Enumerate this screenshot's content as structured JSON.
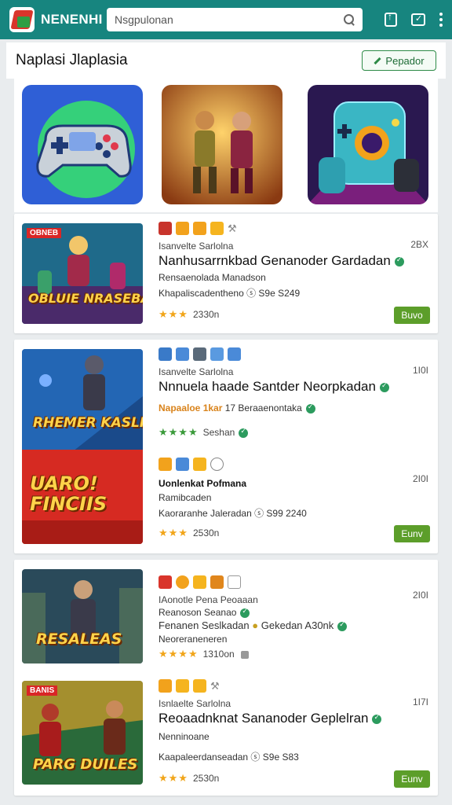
{
  "app": {
    "brand": "NENENHI"
  },
  "search": {
    "placeholder": "Nsgpulonan"
  },
  "section": {
    "title": "Naplasi Jlaplasia",
    "button_label": "Pepador"
  },
  "entries": [
    {
      "thumb_text": "OBLUIE NRASEBA",
      "thumb_badge": "OBNEB",
      "meta": "Isanvelte Sarlolna",
      "count": "2BX",
      "title": "Nanhusarrnkbad Genanoder Gardadan",
      "line1": "Rensaenolada Manadson",
      "line2": "Khapaliscadentheno ⓢ S9e S249",
      "rating": "2330n",
      "buy": "Buvo"
    },
    {
      "thumb_text": "RHEMER KASLIEUIS",
      "meta": "Isanvelte Sarlolna",
      "count": "1I0I",
      "title": "Nnnuela haade Santder Neorpkadan",
      "line1_orange": "Napaaloe 1kar",
      "line1_rest": "17 Beraaenontaka",
      "rating": "Seshan",
      "buy": ""
    },
    {
      "thumb_text": "UARO! FINCIIS",
      "meta": "Uonlenkat  Pofmana",
      "count": "2I0I",
      "title": "",
      "line1": "Ramibcaden",
      "line2": "Kaoraranhe Jaleradan ⓢ S99 2240",
      "rating": "2530n",
      "buy": "Eunv"
    },
    {
      "thumb_text": "RESALEAS",
      "meta": "IAonotle  Pena Peoaaan",
      "count": "2I0I",
      "line1": "Reanoson Seanao",
      "line2": "Fenanen Seslkadan",
      "line2_extra": "Gekedan A30nk",
      "line3": "Neoreraneneren",
      "rating": "1310on",
      "buy": ""
    },
    {
      "thumb_text": "PARG DUILES",
      "thumb_badge": "BANIS",
      "meta": "Isnlaelte Sarlolna",
      "count": "1I7I",
      "title": "Reoaadnknat Sananoder Geplelran",
      "line1": "Nenninoane",
      "line2": "Kaapaleerdanseadan ⓢ S9e S83",
      "rating": "2530n",
      "buy": "Eunv"
    }
  ],
  "colors": {
    "topbar": "#17857f",
    "buy": "#5c9e2a",
    "star": "#f1a51a",
    "accent_green": "#2c9b5e"
  }
}
